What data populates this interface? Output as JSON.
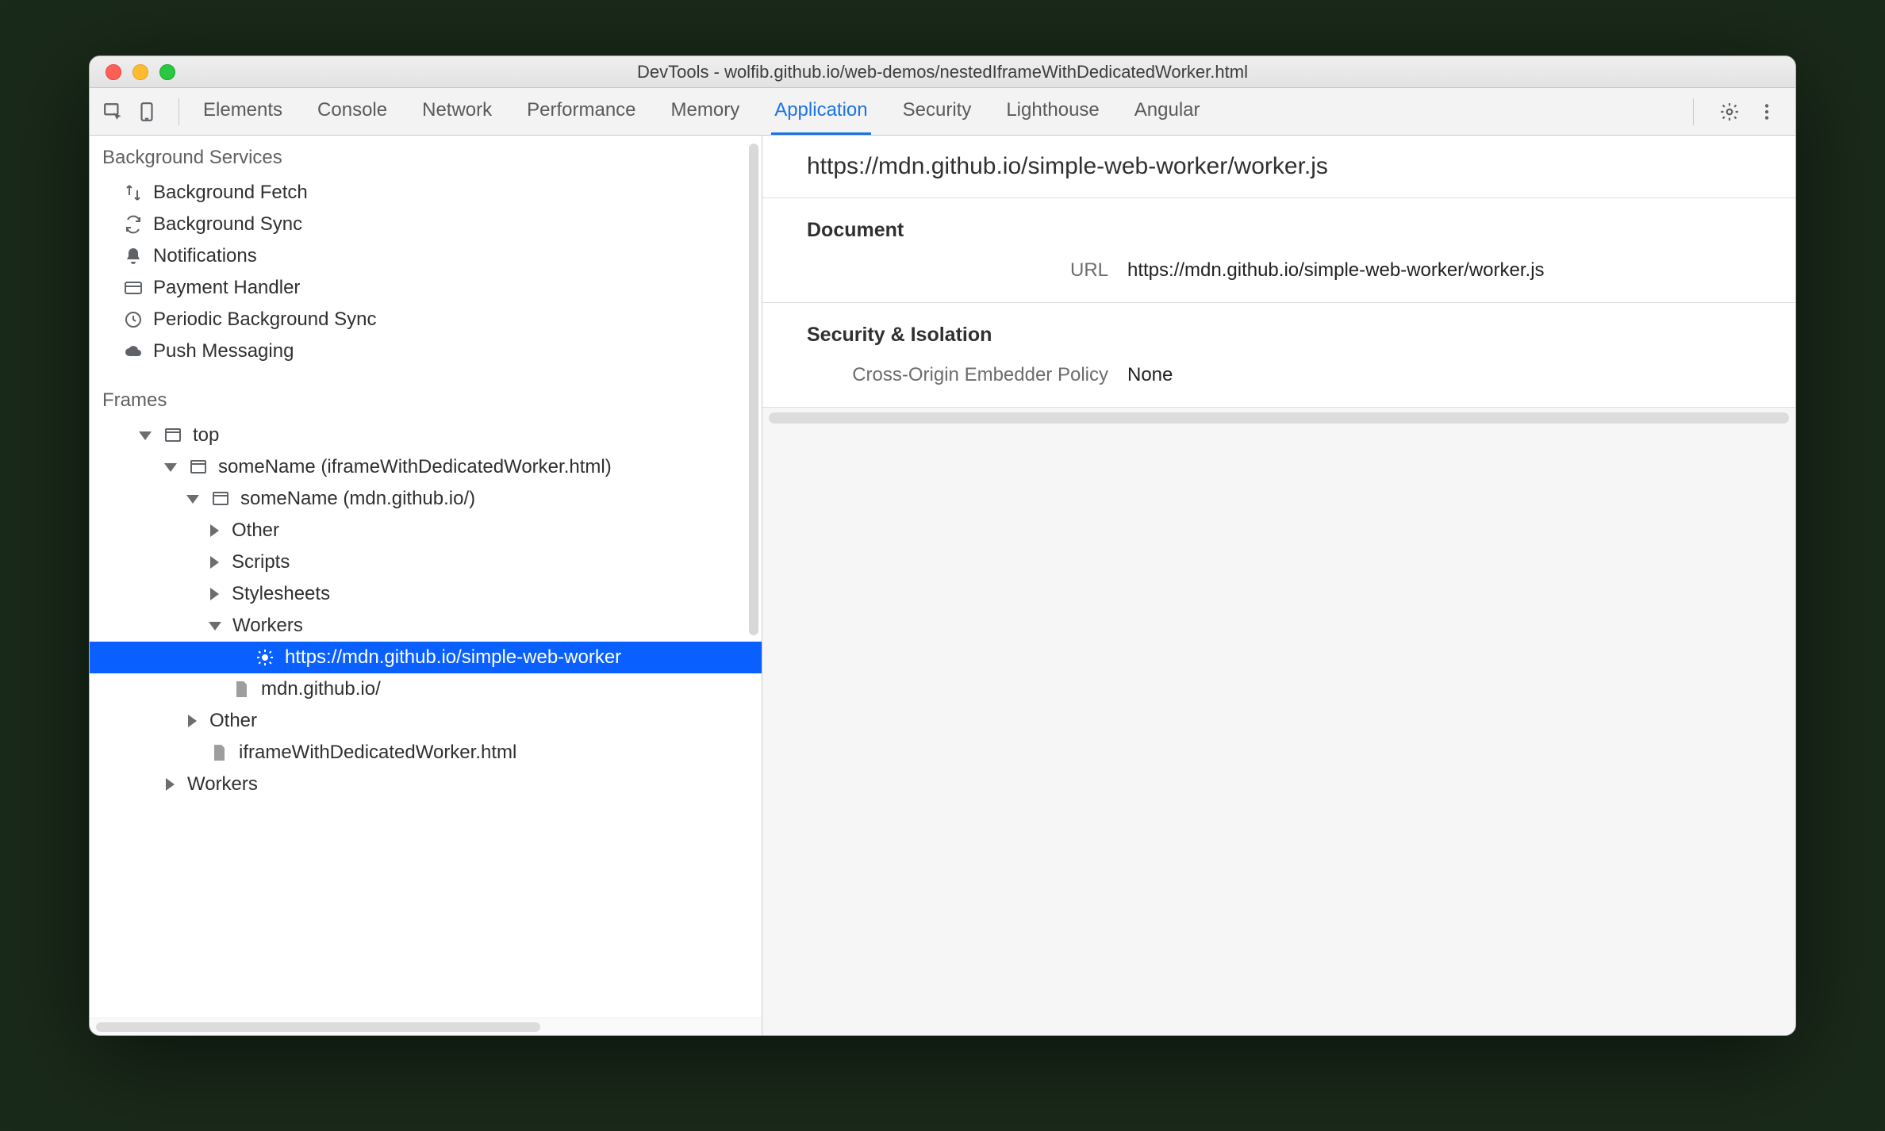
{
  "window": {
    "title": "DevTools - wolfib.github.io/web-demos/nestedIframeWithDedicatedWorker.html"
  },
  "tabs": [
    "Elements",
    "Console",
    "Network",
    "Performance",
    "Memory",
    "Application",
    "Security",
    "Lighthouse",
    "Angular"
  ],
  "active_tab": "Application",
  "sidebar": {
    "bg_section": "Background Services",
    "bg_items": [
      "Background Fetch",
      "Background Sync",
      "Notifications",
      "Payment Handler",
      "Periodic Background Sync",
      "Push Messaging"
    ],
    "frames_section": "Frames",
    "tree": {
      "top": "top",
      "l1": "someName (iframeWithDedicatedWorker.html)",
      "l2": "someName (mdn.github.io/)",
      "l3a": "Other",
      "l3b": "Scripts",
      "l3c": "Stylesheets",
      "l3d": "Workers",
      "l4sel": "https://mdn.github.io/simple-web-worker",
      "l3file": "mdn.github.io/",
      "l2other": "Other",
      "l2file": "iframeWithDedicatedWorker.html",
      "l1workers": "Workers"
    }
  },
  "detail": {
    "title": "https://mdn.github.io/simple-web-worker/worker.js",
    "doc_section": "Document",
    "url_label": "URL",
    "url_value": "https://mdn.github.io/simple-web-worker/worker.js",
    "sec_section": "Security & Isolation",
    "coep_label": "Cross-Origin Embedder Policy",
    "coep_value": "None"
  }
}
